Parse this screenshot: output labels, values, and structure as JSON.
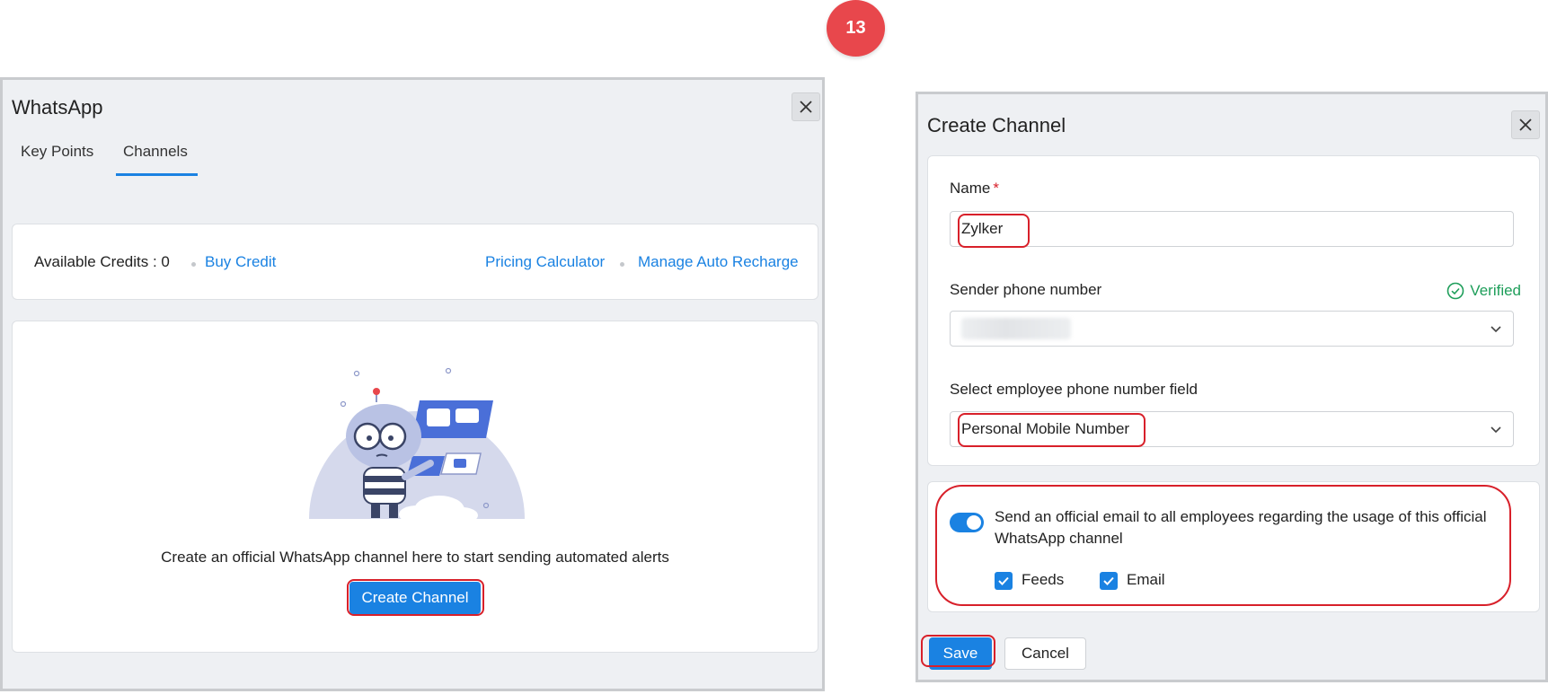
{
  "step_badge": "13",
  "whatsapp_panel": {
    "title": "WhatsApp",
    "tabs": [
      {
        "label": "Key Points",
        "active": false
      },
      {
        "label": "Channels",
        "active": true
      }
    ],
    "credits": {
      "label": "Available Credits : 0",
      "buy_credit": "Buy Credit",
      "pricing_calculator": "Pricing Calculator",
      "manage_auto_recharge": "Manage Auto Recharge"
    },
    "empty_state": {
      "message": "Create an official WhatsApp channel here to start sending automated alerts",
      "create_button": "Create Channel"
    }
  },
  "create_channel_panel": {
    "title": "Create Channel",
    "name": {
      "label": "Name",
      "required_mark": "*",
      "value": "Zylker"
    },
    "sender_phone": {
      "label": "Sender phone number",
      "status": "Verified"
    },
    "employee_phone_field": {
      "label": "Select employee phone number field",
      "value": "Personal Mobile Number"
    },
    "official_email_option": {
      "text": "Send an official email to all employees regarding the usage of this official WhatsApp channel",
      "enabled": true,
      "checkboxes": [
        {
          "label": "Feeds",
          "checked": true
        },
        {
          "label": "Email",
          "checked": true
        }
      ]
    },
    "buttons": {
      "save": "Save",
      "cancel": "Cancel"
    }
  },
  "colors": {
    "accent": "#1a82e2",
    "highlight": "#d8202a",
    "verified": "#1e9e5a",
    "badge": "#e8474c"
  }
}
